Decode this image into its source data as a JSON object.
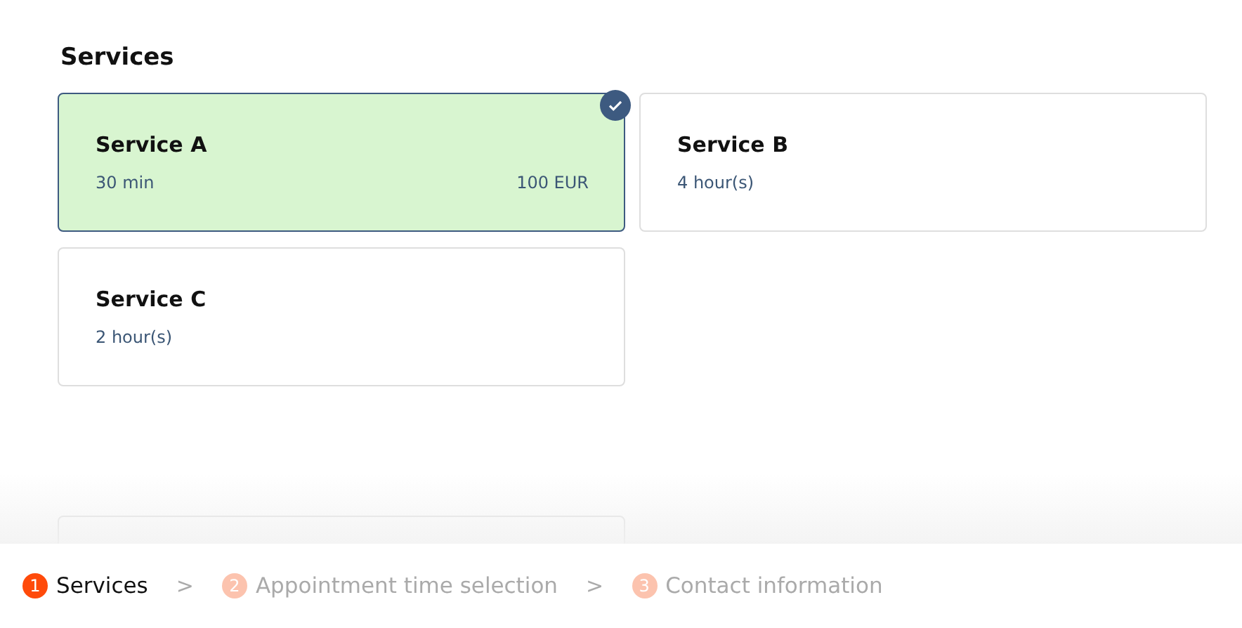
{
  "section": {
    "title": "Services"
  },
  "services": [
    {
      "name": "Service A",
      "duration": "30 min",
      "price": "100 EUR",
      "selected": true
    },
    {
      "name": "Service B",
      "duration": "4 hour(s)",
      "selected": false
    },
    {
      "name": "Service C",
      "duration": "2 hour(s)",
      "selected": false
    }
  ],
  "steps": [
    {
      "number": "1",
      "label": "Services",
      "selected": true
    },
    {
      "number": "2",
      "label": "Appointment time selection",
      "selected": false
    },
    {
      "number": "3",
      "label": "Contact information",
      "selected": false
    }
  ],
  "step_separators": [
    ">",
    ">"
  ]
}
